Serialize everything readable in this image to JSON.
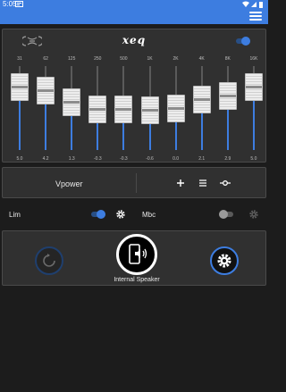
{
  "status_bar": {
    "time": "5:05"
  },
  "header": {
    "brand": "xeq",
    "eq_enabled": true
  },
  "equalizer": {
    "bands": [
      {
        "freq": "31",
        "gain": "5.0"
      },
      {
        "freq": "62",
        "gain": "4.2"
      },
      {
        "freq": "125",
        "gain": "1.3"
      },
      {
        "freq": "250",
        "gain": "-0.3"
      },
      {
        "freq": "500",
        "gain": "-0.3"
      },
      {
        "freq": "1K",
        "gain": "-0.6"
      },
      {
        "freq": "2K",
        "gain": "0.0"
      },
      {
        "freq": "4K",
        "gain": "2.1"
      },
      {
        "freq": "8K",
        "gain": "2.9"
      },
      {
        "freq": "16K",
        "gain": "5.0"
      }
    ],
    "range_db": [
      -10,
      10
    ]
  },
  "vpower": {
    "label": "Vpower",
    "icons": [
      "add-icon",
      "list-icon",
      "slider-adjust-icon"
    ]
  },
  "lim": {
    "label": "Lim",
    "enabled": true
  },
  "mbc": {
    "label": "Mbc",
    "enabled": false
  },
  "controls": {
    "reset_icon": "reset-icon",
    "device_icon": "phone-speaker-icon",
    "settings_icon": "gear-icon",
    "speaker_label": "Internal Speaker"
  },
  "colors": {
    "accent": "#3d7de0",
    "background": "#1c1c1c",
    "panel": "#303030"
  }
}
